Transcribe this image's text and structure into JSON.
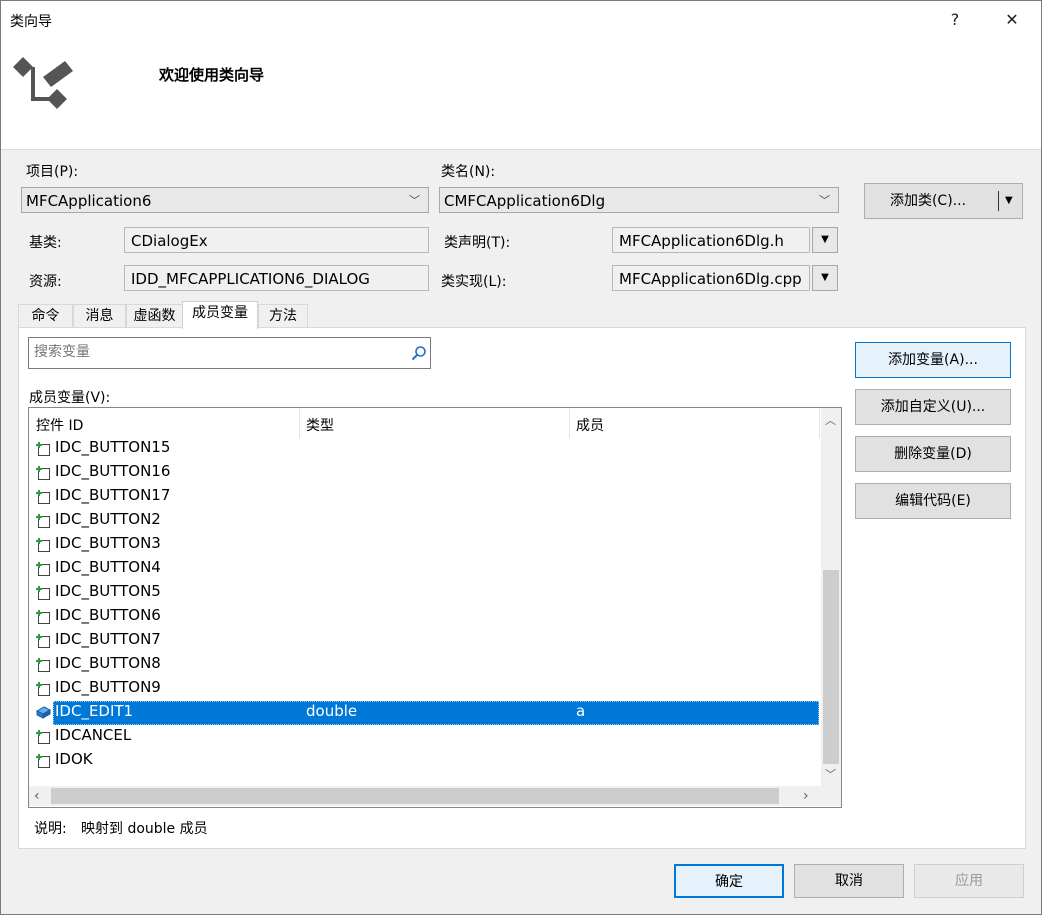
{
  "window": {
    "title": "类向导",
    "help_glyph": "?",
    "close_glyph": "✕"
  },
  "header": {
    "welcome": "欢迎使用类向导"
  },
  "form": {
    "project_label": "项目(P):",
    "project_value": "MFCApplication6",
    "classname_label": "类名(N):",
    "classname_value": "CMFCApplication6Dlg",
    "add_class_label": "添加类(C)...",
    "base_label": "基类:",
    "base_value": "CDialogEx",
    "resource_label": "资源:",
    "resource_value": "IDD_MFCAPPLICATION6_DIALOG",
    "decl_label": "类声明(T):",
    "decl_value": "MFCApplication6Dlg.h",
    "impl_label": "类实现(L):",
    "impl_value": "MFCApplication6Dlg.cpp"
  },
  "tabs": [
    "命令",
    "消息",
    "虚函数",
    "成员变量",
    "方法"
  ],
  "active_tab": "成员变量",
  "search": {
    "placeholder": "搜索变量"
  },
  "members": {
    "label": "成员变量(V):",
    "columns": [
      "控件 ID",
      "类型",
      "成员"
    ],
    "rows": [
      {
        "id": "IDC_BUTTON15",
        "type": "",
        "member": "",
        "icon": "control-add-icon"
      },
      {
        "id": "IDC_BUTTON16",
        "type": "",
        "member": "",
        "icon": "control-add-icon"
      },
      {
        "id": "IDC_BUTTON17",
        "type": "",
        "member": "",
        "icon": "control-add-icon"
      },
      {
        "id": "IDC_BUTTON2",
        "type": "",
        "member": "",
        "icon": "control-add-icon"
      },
      {
        "id": "IDC_BUTTON3",
        "type": "",
        "member": "",
        "icon": "control-add-icon"
      },
      {
        "id": "IDC_BUTTON4",
        "type": "",
        "member": "",
        "icon": "control-add-icon"
      },
      {
        "id": "IDC_BUTTON5",
        "type": "",
        "member": "",
        "icon": "control-add-icon"
      },
      {
        "id": "IDC_BUTTON6",
        "type": "",
        "member": "",
        "icon": "control-add-icon"
      },
      {
        "id": "IDC_BUTTON7",
        "type": "",
        "member": "",
        "icon": "control-add-icon"
      },
      {
        "id": "IDC_BUTTON8",
        "type": "",
        "member": "",
        "icon": "control-add-icon"
      },
      {
        "id": "IDC_BUTTON9",
        "type": "",
        "member": "",
        "icon": "control-add-icon"
      },
      {
        "id": "IDC_EDIT1",
        "type": "double",
        "member": "a",
        "icon": "variable-icon",
        "selected": true
      },
      {
        "id": "IDCANCEL",
        "type": "",
        "member": "",
        "icon": "control-add-icon"
      },
      {
        "id": "IDOK",
        "type": "",
        "member": "",
        "icon": "control-add-icon"
      }
    ]
  },
  "side_buttons": {
    "add_variable": "添加变量(A)...",
    "add_custom": "添加自定义(U)...",
    "delete_variable": "删除变量(D)",
    "edit_code": "编辑代码(E)"
  },
  "description": {
    "label": "说明:",
    "text": "映射到 double 成员"
  },
  "footer": {
    "ok": "确定",
    "cancel": "取消",
    "apply": "应用"
  },
  "colors": {
    "selection": "#0078d7",
    "focus_border": "#0078d7",
    "dialog_bg": "#f0f0f0"
  }
}
